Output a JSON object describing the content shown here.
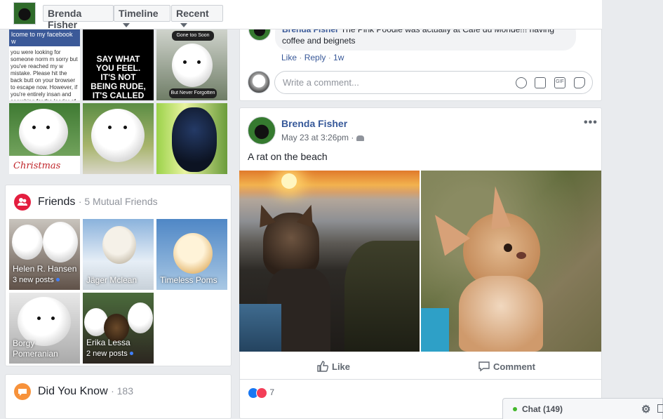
{
  "header": {
    "name": "Brenda Fisher",
    "timeline_label": "Timeline",
    "recent_label": "Recent"
  },
  "left": {
    "tile_welcome_bar": "lcome to my facebook w",
    "tile_welcome_body": "you were looking for someone norm m sorry but you've reached my w mistake. Please hit the back butt on your browser to escape now. However, if you're entirely insan and searching for the leader of your kind, you've found me. Welcome home.",
    "tile_quote": "SAY WHAT YOU FEEL. IT'S NOT BEING RUDE, IT'S CALLED BEING REAL",
    "tile_soon_top": "Gone too Soon",
    "tile_soon_bottom": "But Never Forgotten",
    "tile_christmas": "Christmas",
    "friends_title": "Friends",
    "friends_sub": "· 5 Mutual Friends",
    "friends": [
      {
        "name": "Helen R. Hansen",
        "sub": "3 new posts"
      },
      {
        "name": "Jäger Mclean",
        "sub": ""
      },
      {
        "name": "Timeless Poms",
        "sub": ""
      },
      {
        "name": "Borgy Pomeranian",
        "sub": ""
      },
      {
        "name": "Erika Lessa",
        "sub": "2 new posts"
      }
    ],
    "didyouknow_title": "Did You Know",
    "didyouknow_count": "· 183"
  },
  "feed": {
    "prev_comment_name": "Brenda Fisher",
    "prev_comment_text": "The Pink Poodle was actually at Cafe du Monde!!! having coffee and beignets",
    "prev_like": "Like",
    "prev_reply": "Reply",
    "prev_time": "1w",
    "write_placeholder": "Write a comment...",
    "post": {
      "author": "Brenda Fisher",
      "time": "May 23 at 3:26pm",
      "text": "A rat on the beach",
      "like_label": "Like",
      "comment_label": "Comment",
      "reaction_count": "7"
    }
  },
  "chat": {
    "label": "Chat (149)"
  },
  "colors": {
    "link": "#385898",
    "friends_icon": "#e41e3f",
    "didyouknow_icon": "#f7923b",
    "online": "#42b72a",
    "like_blue": "#1877f2",
    "love_red": "#f33e58"
  }
}
